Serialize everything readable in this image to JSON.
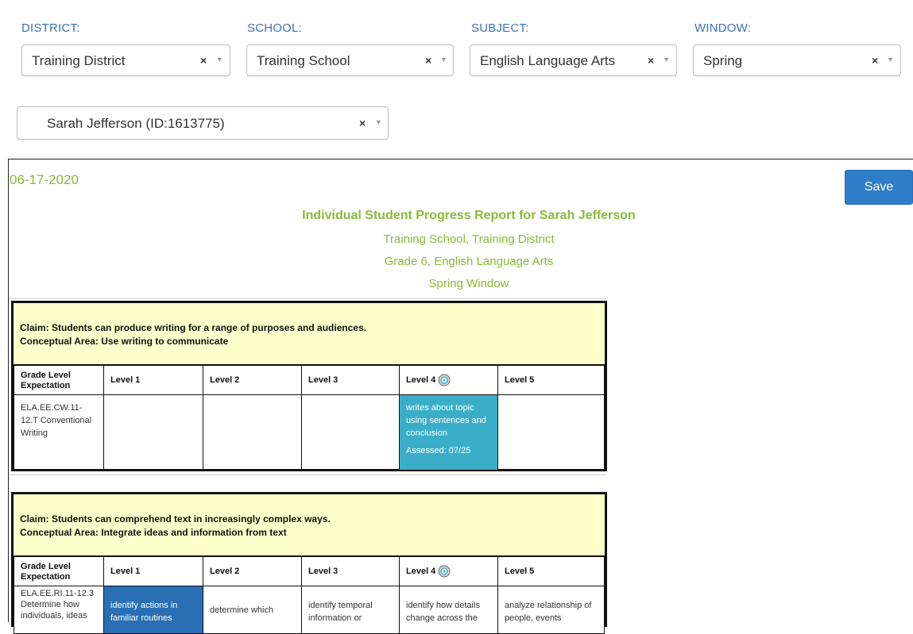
{
  "filters": [
    {
      "label": "DISTRICT:",
      "value": "Training District"
    },
    {
      "label": "SCHOOL:",
      "value": "Training School"
    },
    {
      "label": "SUBJECT:",
      "value": "English Language Arts"
    },
    {
      "label": "WINDOW:",
      "value": "Spring"
    }
  ],
  "student_select": {
    "value": "Sarah Jefferson (ID:1613775)"
  },
  "date": "06-17-2020",
  "save_label": "Save",
  "report": {
    "title": "Individual Student Progress Report for Sarah Jefferson",
    "school_line": "Training School, Training District",
    "grade_line": "Grade 6, English Language Arts",
    "window_line": "Spring Window"
  },
  "claims": [
    {
      "claim": "Claim: Students can produce writing for a range of purposes and audiences.",
      "area": "Conceptual Area: Use writing to communicate",
      "headers": [
        "Grade Level Expectation",
        "Level 1",
        "Level 2",
        "Level 3",
        "Level 4",
        "Level 5"
      ],
      "expectation": "ELA.EE.CW.11-12.T Conventional Writing",
      "level4_text": "writes about topic using sentences and conclusion",
      "level4_assessed": "Assessed: 07/25"
    },
    {
      "claim": "Claim: Students can comprehend text in increasingly complex ways.",
      "area": "Conceptual Area: Integrate ideas and information from text",
      "headers": [
        "Grade Level Expectation",
        "Level 1",
        "Level 2",
        "Level 3",
        "Level 4",
        "Level 5"
      ],
      "expectation": "ELA.EE.RI.11-12.3 Determine how individuals, ideas",
      "levels": [
        "identify actions in familiar routines",
        "determine which",
        "identify temporal information or",
        "identify how details change across the",
        "analyze relationship of people, events"
      ]
    }
  ],
  "colors": {
    "label_blue": "#3b73b9",
    "date_green": "#8cb83a",
    "save_blue": "#2f7cc8",
    "assessed_teal": "#3aaec8",
    "level1_blue": "#2a6fb3",
    "claim_yellow": "#ffffcc"
  }
}
